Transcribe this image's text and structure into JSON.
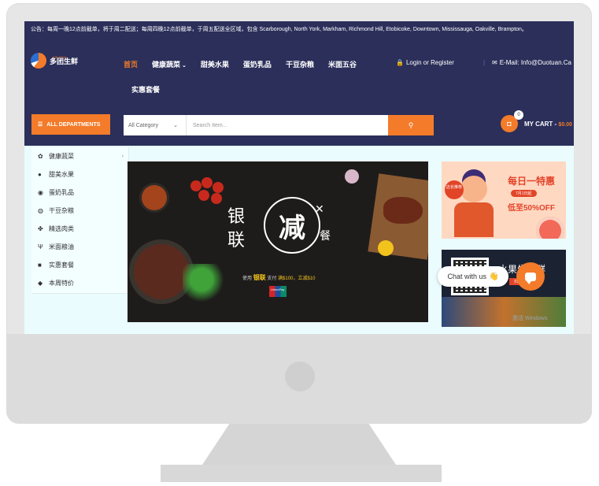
{
  "notice": "公告：每周一晚12点前截单，将于周二配送；每周四晚12点前截单，于周五配送全区域，包含 Scarborough, North York, Markham, Richmond Hill, Etobicoke, Downtown, Mississauga, Oakville, Brampton。",
  "logo": {
    "name": "多团生鲜",
    "tagline": "WE DEAL"
  },
  "nav": {
    "items": [
      {
        "label": "首页"
      },
      {
        "label": "健康蔬菜"
      },
      {
        "label": "甜美水果"
      },
      {
        "label": "蛋奶乳品"
      },
      {
        "label": "干豆杂粮"
      },
      {
        "label": "米面五谷"
      }
    ],
    "second_row": "实惠套餐"
  },
  "account": {
    "login": "Login or Register",
    "email": "E-Mail: Info@Duotuan.Ca"
  },
  "departments": {
    "label": "ALL DEPARTMENTS"
  },
  "search": {
    "category": "All Category",
    "placeholder": "Search Item..."
  },
  "cart": {
    "count": "0",
    "label": "MY CART -",
    "total": "$0.00"
  },
  "side_menu": [
    {
      "label": "健康蔬菜",
      "icon": "leaf-icon",
      "has_submenu": true
    },
    {
      "label": "甜美水果",
      "icon": "apple-icon"
    },
    {
      "label": "蛋奶乳品",
      "icon": "egg-icon"
    },
    {
      "label": "干豆杂粮",
      "icon": "globe-icon"
    },
    {
      "label": "精选肉类",
      "icon": "paw-icon"
    },
    {
      "label": "米面粮油",
      "icon": "utensils-icon"
    },
    {
      "label": "实惠套餐",
      "icon": "gift-icon"
    },
    {
      "label": "本周特价",
      "icon": "tag-icon"
    }
  ],
  "banner": {
    "left_text_top": "银",
    "left_text_bottom": "联",
    "circle_text": "减",
    "right_text": "餐",
    "subtitle_pre": "使用",
    "subtitle_highlight": "银联",
    "subtitle_mid": "支付",
    "subtitle_amount": "满$100，立减$10",
    "card_label": "UnionPay"
  },
  "promo_top": {
    "bubble": "店长推荐",
    "title": "每日一特惠",
    "date": "7月1日起",
    "off": "低至50%OFF"
  },
  "promo_bottom": {
    "title": "水果生鲜群",
    "tag": "扫码加群"
  },
  "watermark": "激活 Windows",
  "chat": {
    "label": "Chat with us",
    "emoji": "👋"
  },
  "colors": {
    "navy": "#2b2f5a",
    "accent": "#f37b2a"
  }
}
